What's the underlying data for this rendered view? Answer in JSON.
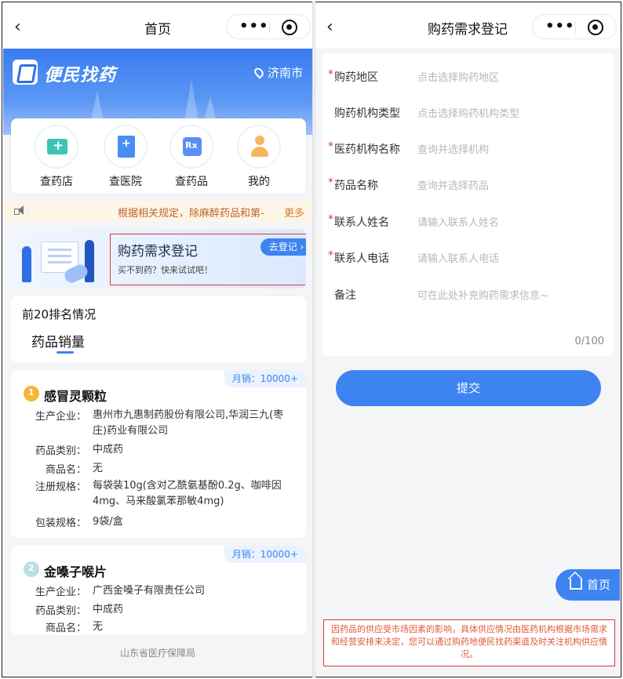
{
  "left": {
    "topbar": {
      "back_icon": "chevron-left-icon",
      "title": "首页"
    },
    "hero": {
      "logo_text": "便民找药",
      "location": "济南市"
    },
    "nav": [
      {
        "label": "查药店",
        "icon": "pharmacy-icon"
      },
      {
        "label": "查医院",
        "icon": "hospital-icon"
      },
      {
        "label": "查药品",
        "icon": "medicine-icon"
      },
      {
        "label": "我的",
        "icon": "user-icon"
      }
    ],
    "notice": {
      "text": "根据相关规定，除麻醉药品和第-",
      "more": "更多"
    },
    "banner": {
      "title": "购药需求登记",
      "subtitle": "买不到药？快来试试吧！",
      "button": "去登记 ›"
    },
    "ranking": {
      "title": "前20排名情况",
      "tab": "药品销量"
    },
    "drugs": [
      {
        "rank": "1",
        "name": "感冒灵颗粒",
        "sales": "月销：10000+",
        "fields": [
          {
            "k": "生产企业：",
            "v": "惠州市九惠制药股份有限公司,华润三九(枣庄)药业有限公司"
          },
          {
            "k": "药品类别：",
            "v": "中成药"
          },
          {
            "k": "商品名：",
            "v": "无"
          },
          {
            "k": "注册规格：",
            "v": "每袋装10g(含对乙酰氨基酚0.2g、咖啡因4mg、马来酸氯苯那敏4mg)"
          },
          {
            "k": "包装规格：",
            "v": "9袋/盒"
          }
        ]
      },
      {
        "rank": "2",
        "name": "金嗓子喉片",
        "sales": "月销：10000+",
        "fields": [
          {
            "k": "生产企业：",
            "v": "广西金嗓子有限责任公司"
          },
          {
            "k": "药品类别：",
            "v": "中成药"
          },
          {
            "k": "商品名：",
            "v": "无"
          }
        ]
      }
    ],
    "footer": "山东省医疗保障局"
  },
  "right": {
    "topbar": {
      "back_icon": "chevron-left-icon",
      "title": "购药需求登记"
    },
    "form": [
      {
        "required": true,
        "label": "购药地区",
        "placeholder": "点击选择购药地区"
      },
      {
        "required": false,
        "label": "购药机构类型",
        "placeholder": "点击选择购药机构类型"
      },
      {
        "required": true,
        "label": "医药机构名称",
        "placeholder": "查询并选择机构"
      },
      {
        "required": true,
        "label": "药品名称",
        "placeholder": "查询并选择药品"
      },
      {
        "required": true,
        "label": "联系人姓名",
        "placeholder": "请输入联系人姓名"
      },
      {
        "required": true,
        "label": "联系人电话",
        "placeholder": "请输入联系人电话"
      },
      {
        "required": false,
        "label": "备注",
        "placeholder": "可在此处补充购药需求信息~"
      }
    ],
    "counter": "0/100",
    "submit": "提交",
    "home_button": "首页",
    "disclaimer": "因药品的供应受市场因素的影响，具体供应情况由医药机构根据市场需求和经营安排来决定，您可以通过购药地便民找药渠道及时关注机构供应情况。"
  },
  "colors": {
    "primary": "#3e84f1",
    "highlight_border": "#d93b3b",
    "required": "#e03a3a",
    "notice_text": "#c0622d"
  }
}
